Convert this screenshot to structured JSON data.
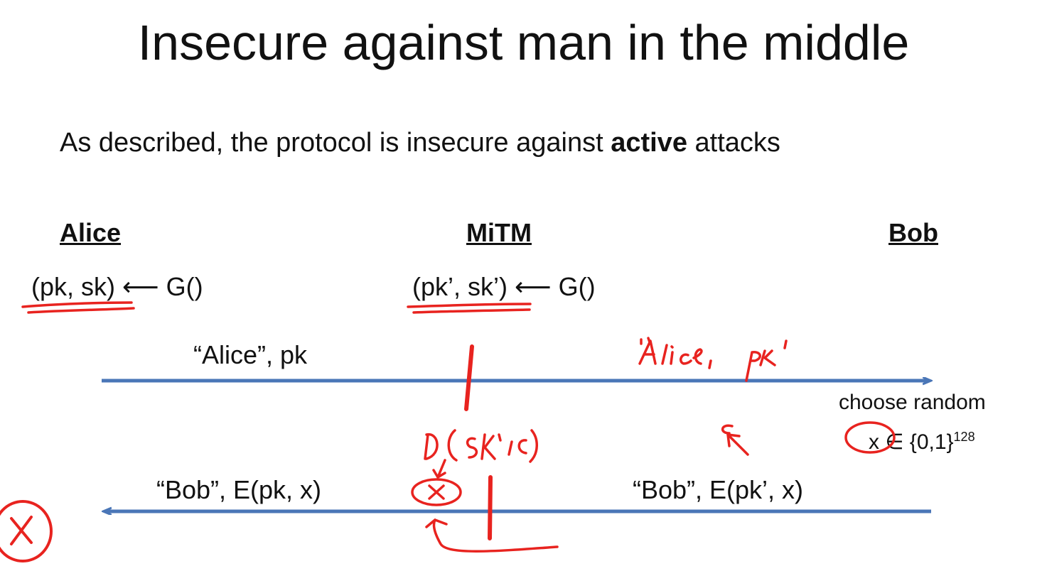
{
  "slide": {
    "title": "Insecure against man in the middle",
    "subtitle_prefix": "As described, the protocol is insecure against ",
    "subtitle_bold": "active",
    "subtitle_suffix": " attacks"
  },
  "parties": {
    "alice": "Alice",
    "mitm": "MiTM",
    "bob": "Bob"
  },
  "keygen": {
    "alice": "(pk, sk) ⟵ G()",
    "mitm": "(pk’, sk’) ⟵ G()"
  },
  "messages": {
    "alice_to_mitm": "“Alice”,  pk",
    "bob_to_mitm": "“Bob”,  E(pk’, x)",
    "mitm_to_alice": "“Bob”,  E(pk, x)"
  },
  "bob_step": {
    "line1": "choose random",
    "line2_prefix": "x ∈ {0,1}",
    "line2_exp": "128"
  },
  "colors": {
    "arrow": "#4a76b7",
    "annotation": "#e8231f",
    "text": "#111111"
  }
}
